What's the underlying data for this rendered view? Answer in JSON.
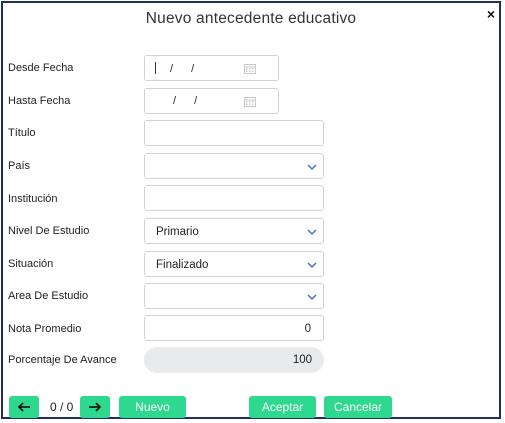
{
  "dialog": {
    "title": "Nuevo antecedente educativo",
    "close_glyph": "×"
  },
  "form": {
    "desde_fecha": {
      "label": "Desde Fecha",
      "value_sep1": "/",
      "value_sep2": "/",
      "icon": "calendar-icon"
    },
    "hasta_fecha": {
      "label": "Hasta Fecha",
      "value_sep1": "/",
      "value_sep2": "/",
      "icon": "calendar-icon"
    },
    "titulo": {
      "label": "Título",
      "value": ""
    },
    "pais": {
      "label": "País",
      "value": "",
      "icon": "chevron-down-icon"
    },
    "institucion": {
      "label": "Institución",
      "value": ""
    },
    "nivel_de_estudio": {
      "label": "Nivel De Estudio",
      "value": "Primario",
      "icon": "chevron-down-icon"
    },
    "situacion": {
      "label": "Situación",
      "value": "Finalizado",
      "icon": "chevron-down-icon"
    },
    "area_de_estudio": {
      "label": "Area De Estudio",
      "value": "",
      "icon": "chevron-down-icon"
    },
    "nota_promedio": {
      "label": "Nota Promedio",
      "value": "0"
    },
    "porcentaje_de_avance": {
      "label": "Porcentaje De Avance",
      "value": "100"
    }
  },
  "footer": {
    "prev_icon": "arrow-left-icon",
    "next_icon": "arrow-right-icon",
    "counter": "0 / 0",
    "nuevo_label": "Nuevo",
    "aceptar_label": "Aceptar",
    "cancelar_label": "Cancelar"
  },
  "colors": {
    "accent_green": "#2ed88f",
    "dialog_border": "#1f2f57",
    "chevron_blue": "#3a66c9",
    "field_border": "#cfd3d8",
    "progress_bg": "#e9eaec"
  }
}
